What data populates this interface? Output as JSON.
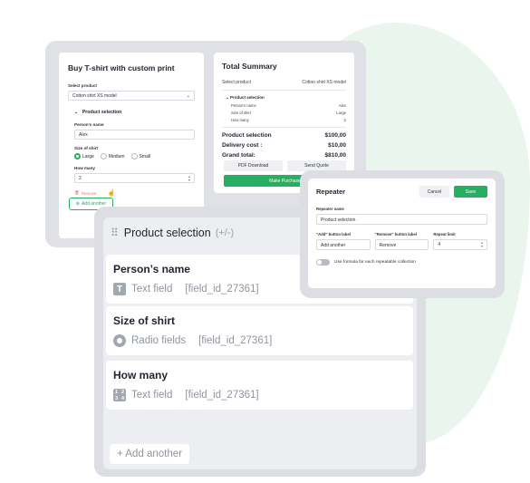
{
  "colors": {
    "accent": "#27ae60",
    "blob": "#eaf5ee",
    "frame": "#dcdee4"
  },
  "form": {
    "title": "Buy T-shirt with custom print",
    "select_label": "Select product",
    "select_value": "Cotton shirt XS model",
    "group_title": "Product selection",
    "name_label": "Person's name",
    "name_value": "Alex",
    "size_label": "Size of shirt",
    "size_options": [
      "Large",
      "Medium",
      "Small"
    ],
    "size_selected": "Large",
    "qty_label": "How many",
    "qty_value": "2",
    "remove_label": "Remove",
    "add_label": "Add another"
  },
  "summary": {
    "title": "Total Summary",
    "product_label": "Select product",
    "product_value": "Cotton shirt XS model",
    "group_title": "Product selection",
    "items": [
      {
        "k": "Person's name",
        "v": "Alex"
      },
      {
        "k": "Size of shirt",
        "v": "Large"
      },
      {
        "k": "How many",
        "v": "2"
      }
    ],
    "totals": [
      {
        "k": "Product selection",
        "v": "$100,00"
      },
      {
        "k": "Delivery cost :",
        "v": "$10,00"
      },
      {
        "k": "Grand total:",
        "v": "$810,00"
      }
    ],
    "pdf_label": "PDF Download",
    "quote_label": "Send Quote",
    "purchase_label": "Make Purchase"
  },
  "main": {
    "title": "Product selection",
    "subtitle": "(+/-)",
    "fields": [
      {
        "name": "Person’s name",
        "type": "Text field",
        "id": "[field_id_27361]"
      },
      {
        "name": "Size of shirt",
        "type": "Radio fields",
        "id": "[field_id_27361]"
      },
      {
        "name": "How many",
        "type": "Text field",
        "id": "[field_id_27361]"
      }
    ],
    "add_label": "+ Add another",
    "num_icon": [
      "1",
      "2",
      "3",
      "4"
    ]
  },
  "repeater": {
    "title": "Repeater",
    "cancel_label": "Cancel",
    "save_label": "Save",
    "name_label": "Repeater name",
    "name_value": "Product selection",
    "add_label_label": "\"Add\" button label",
    "add_label_value": "Add another",
    "remove_label_label": "\"Remove\" button label",
    "remove_label_value": "Remove",
    "limit_label": "Repeat limit",
    "limit_value": "4",
    "toggle_label": "Use formula for each repeatable collection"
  }
}
